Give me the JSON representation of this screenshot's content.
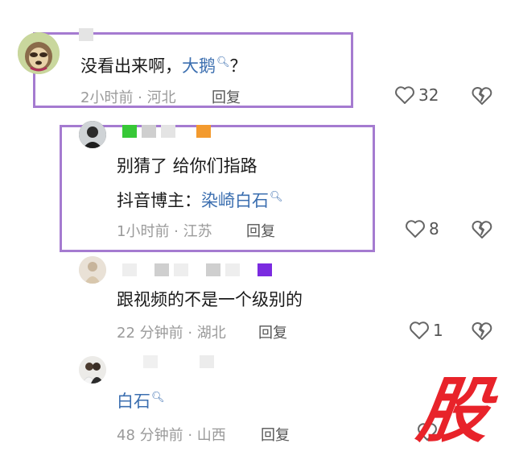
{
  "comments": [
    {
      "text": "没看出来啊，",
      "link": "大鹅",
      "after": "？",
      "time": "2小时前 · 河北",
      "reply": "回复",
      "likes": "32"
    },
    {
      "line1": "别猜了 给你们指路",
      "line2_prefix": "抖音博主：",
      "link": "染崎白石",
      "time": "1小时前 · 江苏",
      "reply": "回复",
      "likes": "8"
    },
    {
      "text": "跟视频的不是一个级别的",
      "time": "22 分钟前 · 湖北",
      "reply": "回复",
      "likes": "1"
    },
    {
      "link": "白石",
      "time": "48 分钟前 · 山西",
      "reply": "回复"
    }
  ],
  "watermark": "股",
  "colors": {
    "highlight": "#a57bd0",
    "link": "#3c6fb0",
    "watermark": "#e8232a"
  },
  "icons": {
    "like": "heart-outline-icon",
    "dislike": "broken-heart-icon",
    "search": "search-small-icon"
  }
}
